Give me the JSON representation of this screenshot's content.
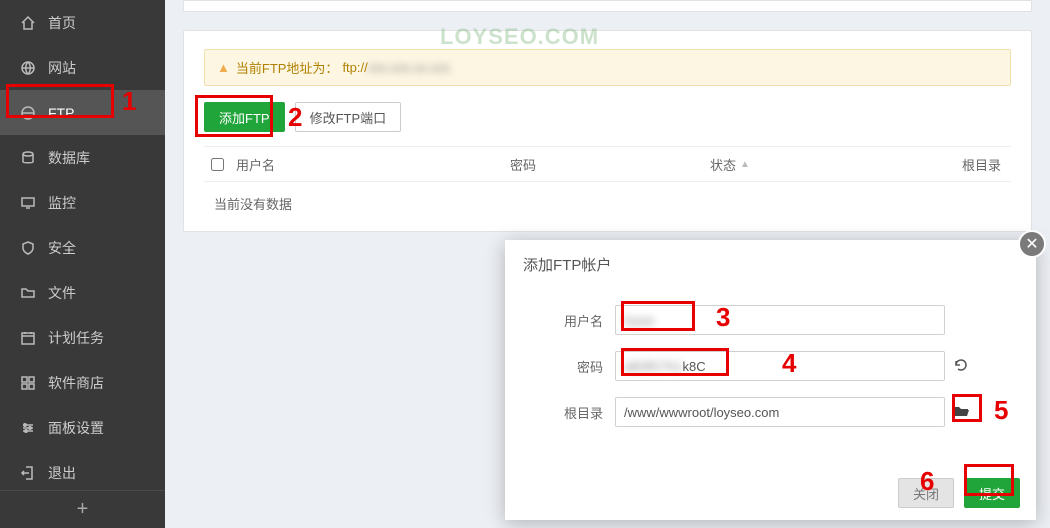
{
  "sidebar": {
    "items": [
      {
        "label": "首页",
        "icon": "home-icon"
      },
      {
        "label": "网站",
        "icon": "globe-icon"
      },
      {
        "label": "FTP",
        "icon": "ftp-icon"
      },
      {
        "label": "数据库",
        "icon": "database-icon"
      },
      {
        "label": "监控",
        "icon": "monitor-icon"
      },
      {
        "label": "安全",
        "icon": "shield-icon"
      },
      {
        "label": "文件",
        "icon": "folder-icon"
      },
      {
        "label": "计划任务",
        "icon": "schedule-icon"
      },
      {
        "label": "软件商店",
        "icon": "app-store-icon"
      },
      {
        "label": "面板设置",
        "icon": "settings-icon"
      },
      {
        "label": "退出",
        "icon": "logout-icon"
      }
    ],
    "active_index": 2,
    "plus": "+"
  },
  "watermark": "LOYSEO.COM",
  "warn_bar": {
    "prefix": "当前FTP地址为：",
    "value": "ftp://",
    "blurred": "xxx.xxx.xx.xxx"
  },
  "buttons": {
    "add_ftp": "添加FTP",
    "edit_port": "修改FTP端口"
  },
  "table": {
    "headers": {
      "user": "用户名",
      "pass": "密码",
      "status": "状态",
      "root": "根目录"
    },
    "empty": "当前没有数据"
  },
  "modal": {
    "title": "添加FTP帐户",
    "labels": {
      "user": "用户名",
      "pass": "密码",
      "root": "根目录"
    },
    "values": {
      "user_blur": "loyse",
      "pass_blur": "aB3fG7h1",
      "pass_suffix": "k8C",
      "root": "/www/wwwroot/loyseo.com"
    },
    "footer": {
      "cancel": "关闭",
      "submit": "提交"
    }
  },
  "annotations": {
    "n1": "1",
    "n2": "2",
    "n3": "3",
    "n4": "4",
    "n5": "5",
    "n6": "6"
  }
}
